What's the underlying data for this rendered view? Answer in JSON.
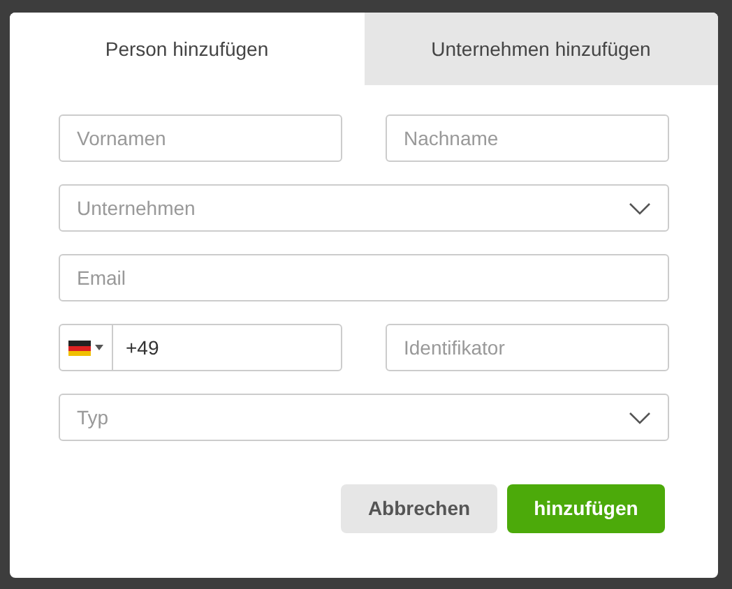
{
  "tabs": [
    {
      "label": "Person hinzufügen",
      "selected": true
    },
    {
      "label": "Unternehmen hinzufügen",
      "selected": false
    }
  ],
  "fields": {
    "first_name": {
      "placeholder": "Vornamen"
    },
    "last_name": {
      "placeholder": "Nachname"
    },
    "company": {
      "placeholder": "Unternehmen"
    },
    "email": {
      "placeholder": "Email"
    },
    "phone": {
      "value": "+49"
    },
    "identifier": {
      "placeholder": "Identifikator"
    },
    "type": {
      "placeholder": "Typ"
    }
  },
  "buttons": {
    "cancel": "Abbrechen",
    "submit": "hinzufügen"
  }
}
